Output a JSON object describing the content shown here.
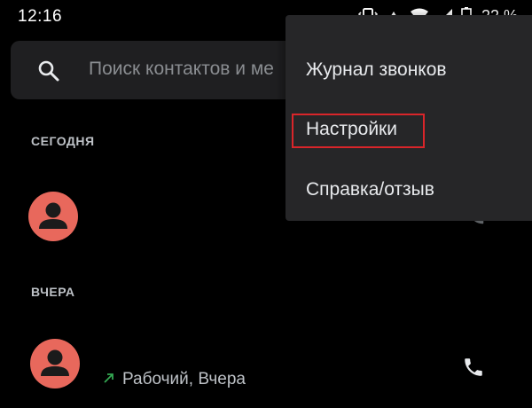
{
  "status_bar": {
    "time": "12:16",
    "battery": "22 %",
    "icons": [
      "vibrate-icon",
      "data-saver-icon",
      "wifi-icon",
      "signal-icon",
      "battery-icon"
    ]
  },
  "search": {
    "placeholder": "Поиск контактов и ме"
  },
  "sections": {
    "today": "СЕГОДНЯ",
    "yesterday": "ВЧЕРА"
  },
  "calls": [
    {
      "detail": "",
      "icon": "phone-icon"
    },
    {
      "direction_icon": "outgoing-call-arrow-icon",
      "detail": "Рабочий, Вчера",
      "icon": "phone-icon"
    }
  ],
  "menu": {
    "items": [
      {
        "label": "Журнал звонков"
      },
      {
        "label": "Настройки",
        "highlighted": true
      },
      {
        "label": "Справка/отзыв"
      }
    ]
  },
  "colors": {
    "background": "#000000",
    "search_bar": "#1f1f21",
    "menu_background": "#262628",
    "avatar": "#e8685c",
    "highlight_border": "#d9252a",
    "outgoing_arrow": "#34a853"
  }
}
